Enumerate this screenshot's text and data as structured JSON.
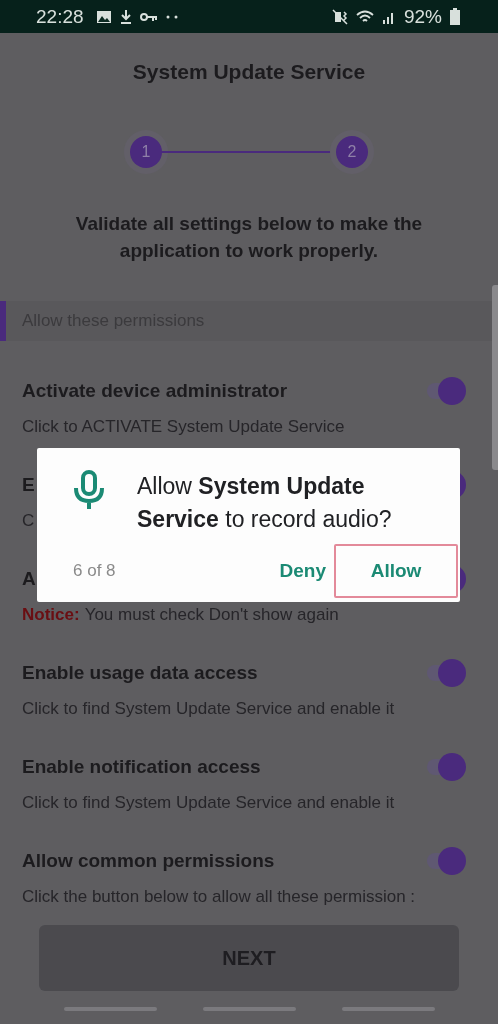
{
  "status_bar": {
    "time": "22:28",
    "battery": "92%"
  },
  "title": "System Update Service",
  "stepper": {
    "steps": [
      {
        "label": "1"
      },
      {
        "label": "2"
      }
    ]
  },
  "instruction": "Validate all settings below to make the application to work properly.",
  "section": "Allow these permissions",
  "rows": [
    {
      "title": "Activate device administrator",
      "description": "Click to ACTIVATE System Update Service",
      "on": true
    },
    {
      "title": "E",
      "description": "C",
      "on": true
    },
    {
      "title": "A",
      "notice_label": "Notice:",
      "description": "You must check Don't show again",
      "on": true
    },
    {
      "title": "Enable usage data access",
      "description": "Click to find System Update Service and enable it",
      "on": true
    },
    {
      "title": "Enable notification access",
      "description": "Click to find System Update Service and enable it",
      "on": true
    },
    {
      "title": "Allow common permissions",
      "description": "Click the button below to allow all these permission :",
      "on": true
    }
  ],
  "next_button": {
    "label": "NEXT",
    "disabled": true
  },
  "dialog": {
    "message": "Allow **System Update Service** to record audio?",
    "counter": "6 of 8",
    "buttons": [
      {
        "label": "Deny",
        "highlighted": false
      },
      {
        "label": "Allow",
        "highlighted": true
      }
    ]
  }
}
